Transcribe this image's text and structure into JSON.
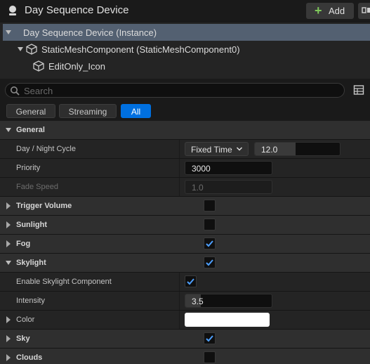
{
  "header": {
    "title": "Day Sequence Device",
    "add_label": "Add",
    "actor_icon": "actor-icon",
    "blueprint_icon": "blueprint-icon"
  },
  "tree": {
    "items": [
      {
        "label": "Day Sequence Device (Instance)",
        "selected": true
      },
      {
        "label": "StaticMeshComponent (StaticMeshComponent0)",
        "expanded": true,
        "icon": "static-mesh-icon"
      },
      {
        "label": "EditOnly_Icon",
        "icon": "static-mesh-icon"
      }
    ]
  },
  "search": {
    "placeholder": "Search",
    "value": ""
  },
  "filters": {
    "tabs": [
      {
        "label": "General",
        "active": false
      },
      {
        "label": "Streaming",
        "active": false
      },
      {
        "label": "All",
        "active": true
      }
    ]
  },
  "details": {
    "general": {
      "label": "General",
      "day_night_cycle": {
        "label": "Day / Night Cycle",
        "mode": "Fixed Time",
        "value": "12.0"
      },
      "priority": {
        "label": "Priority",
        "value": "3000"
      },
      "fade_speed": {
        "label": "Fade Speed",
        "value": "1.0"
      }
    },
    "trigger_volume": {
      "label": "Trigger Volume",
      "checked": false
    },
    "sunlight": {
      "label": "Sunlight",
      "checked": false
    },
    "fog": {
      "label": "Fog",
      "checked": true
    },
    "skylight": {
      "label": "Skylight",
      "checked": true,
      "enable_component": {
        "label": "Enable Skylight Component",
        "checked": true
      },
      "intensity": {
        "label": "Intensity",
        "value": "3.5"
      },
      "color": {
        "label": "Color",
        "value": "#ffffff"
      }
    },
    "sky": {
      "label": "Sky",
      "checked": true
    },
    "clouds": {
      "label": "Clouds",
      "checked": false
    }
  },
  "colors": {
    "accent": "#0070e0",
    "check": "#4d9fff",
    "selected_row": "#536071",
    "add_plus": "#7fc95b"
  }
}
